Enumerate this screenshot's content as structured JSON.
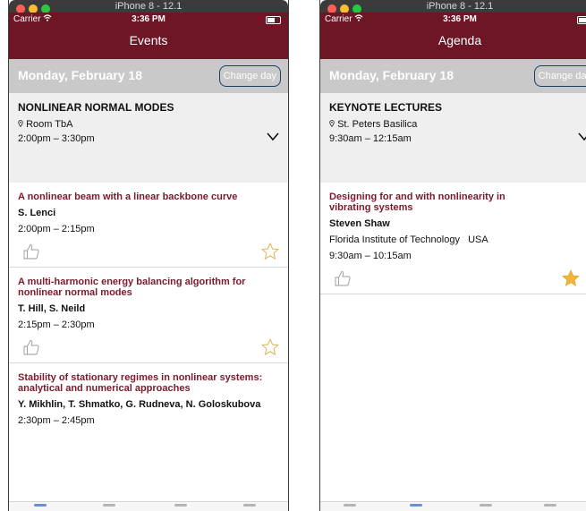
{
  "left": {
    "window_title": "iPhone 8 - 12.1",
    "carrier": "Carrier",
    "time": "3:36 PM",
    "nav_title": "Events",
    "date": "Monday, February 18",
    "change_day": "Change day",
    "session": {
      "title": "NONLINEAR NORMAL MODES",
      "room": "Room TbA",
      "time": "2:00pm – 3:30pm"
    },
    "talks": [
      {
        "title": "A nonlinear beam with a linear backbone curve",
        "authors": "S. Lenci",
        "time": "2:00pm – 2:15pm",
        "starred": false
      },
      {
        "title": "A multi-harmonic energy balancing algorithm for nonlinear normal modes",
        "authors": "T. Hill, S. Neild",
        "time": "2:15pm – 2:30pm",
        "starred": false
      },
      {
        "title": "Stability of stationary regimes in nonlinear systems: analytical and numerical approaches",
        "authors": "Y. Mikhlin, T. Shmatko, G. Rudneva, N. Goloskubova",
        "time": "2:30pm – 2:45pm",
        "starred": false
      }
    ]
  },
  "right": {
    "window_title": "iPhone 8 - 12.1",
    "carrier": "Carrier",
    "time": "3:36 PM",
    "nav_title": "Agenda",
    "date": "Monday, February 18",
    "change_day": "Change day",
    "session": {
      "title": "KEYNOTE LECTURES",
      "room": "St. Peters Basilica",
      "time": "9:30am – 12:15am"
    },
    "talks": [
      {
        "title": "Designing for and with nonlinearity in vibrating systems",
        "authors": "Steven Shaw",
        "affiliation": "Florida Institute of Technology   USA",
        "time": "9:30am – 10:15am",
        "starred": true
      }
    ]
  },
  "colors": {
    "brand": "#6d1626",
    "talk_title": "#7a1a2c",
    "star_filled": "#f2b53a",
    "star_outline": "#e3b24a"
  },
  "icons": [
    "wifi-icon",
    "battery-icon",
    "location-pin-icon",
    "chevron-down-icon",
    "thumbs-up-icon",
    "star-icon"
  ]
}
